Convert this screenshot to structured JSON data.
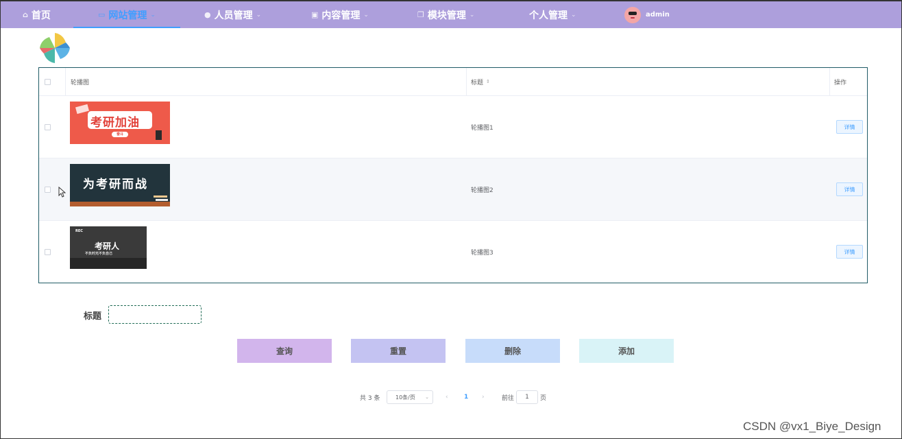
{
  "nav": {
    "items": [
      {
        "label": "首页",
        "icon": "home-icon"
      },
      {
        "label": "网站管理",
        "icon": "monitor-icon"
      },
      {
        "label": "人员管理",
        "icon": "user-icon"
      },
      {
        "label": "内容管理",
        "icon": "document-icon"
      },
      {
        "label": "模块管理",
        "icon": "copy-icon"
      },
      {
        "label": "个人管理",
        "icon": ""
      }
    ],
    "active": "网站管理",
    "user": "admin"
  },
  "table": {
    "columns": [
      "轮播图",
      "标题",
      "操作"
    ],
    "rows": [
      {
        "title": "轮播图1",
        "image_text": "考研加油",
        "image_sub": "奋斗",
        "action": "详情"
      },
      {
        "title": "轮播图2",
        "image_text": "为考研而战",
        "action": "详情"
      },
      {
        "title": "轮播图3",
        "image_text": "考研人",
        "image_sub": "不负时光不负自己",
        "image_corner": "REC",
        "action": "详情"
      }
    ]
  },
  "search": {
    "label": "标题",
    "value": ""
  },
  "buttons": {
    "query": "查询",
    "reset": "重置",
    "delete": "删除",
    "add": "添加"
  },
  "pagination": {
    "total": "共 3 条",
    "page_size": "10条/页",
    "current": "1",
    "goto_label": "前往",
    "goto_value": "1",
    "page_unit": "页"
  },
  "watermark": "CSDN @vx1_Biye_Design",
  "colors": {
    "nav_bg": "#ad9fdc",
    "active": "#409eff",
    "query_btn": "#d2b5ec",
    "reset_btn": "#c4c3f2",
    "delete_btn": "#c7dcfa",
    "add_btn": "#d9f3f7"
  }
}
